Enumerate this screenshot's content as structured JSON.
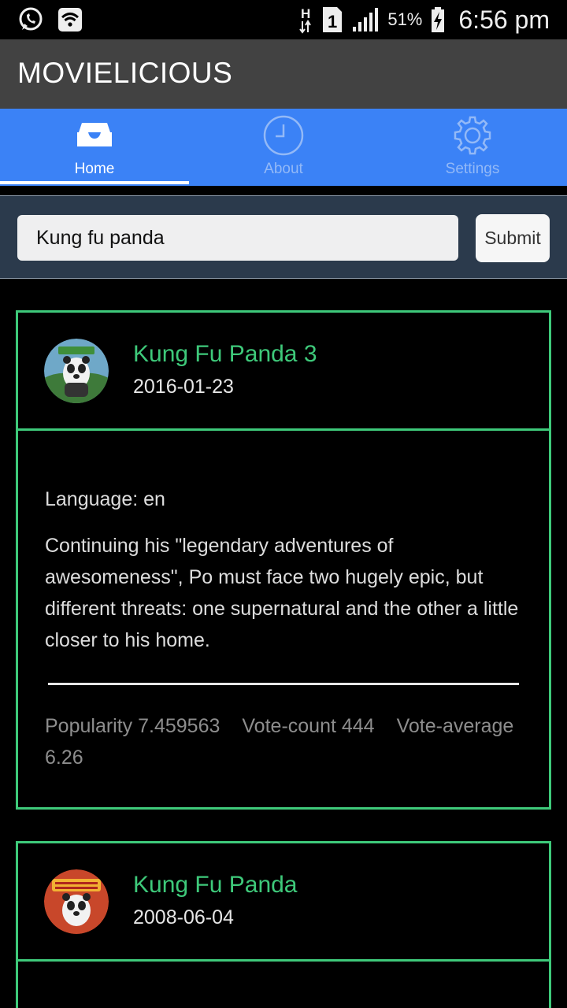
{
  "status_bar": {
    "left_icons": [
      "whatsapp-icon",
      "wifi-icon"
    ],
    "network_label": "H",
    "sim_label": "1",
    "battery_percent": "51%",
    "time": "6:56 pm"
  },
  "app": {
    "title": "MOVIELICIOUS"
  },
  "tabs": [
    {
      "label": "Home",
      "icon": "inbox-icon",
      "active": true
    },
    {
      "label": "About",
      "icon": "clock-icon",
      "active": false
    },
    {
      "label": "Settings",
      "icon": "gear-icon",
      "active": false
    }
  ],
  "search": {
    "value": "Kung fu panda",
    "submit_label": "Submit"
  },
  "movies": [
    {
      "title": "Kung Fu Panda 3",
      "release_date": "2016-01-23",
      "language": "Language: en",
      "overview": "Continuing his \"legendary adventures of awesomeness\", Po must face two hugely epic, but different threats: one supernatural and the other a little closer to his home.",
      "popularity": "Popularity 7.459563",
      "vote_count": "Vote-count 444",
      "vote_average": "Vote-average 6.26"
    },
    {
      "title": "Kung Fu Panda",
      "release_date": "2008-06-04"
    }
  ],
  "colors": {
    "accent_green": "#3ec97a",
    "tab_blue": "#3b82f6",
    "title_bar": "#424242",
    "search_panel": "#2b3a4c"
  }
}
